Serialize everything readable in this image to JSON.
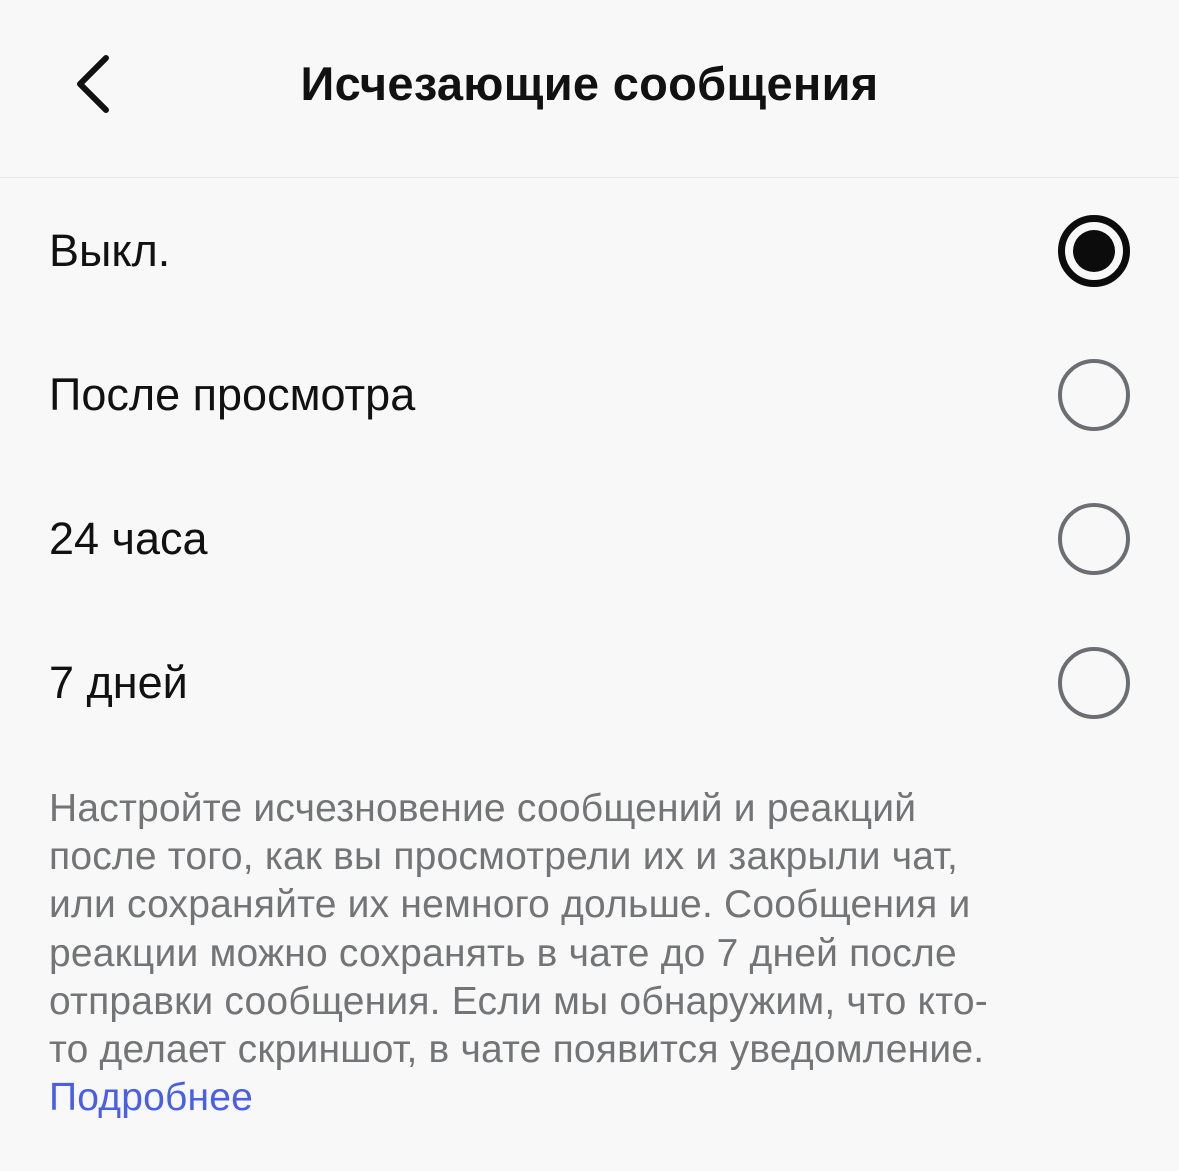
{
  "header": {
    "title": "Исчезающие сообщения",
    "back_icon": "chevron-left-icon"
  },
  "options": [
    {
      "label": "Выкл.",
      "selected": true
    },
    {
      "label": "После просмотра",
      "selected": false
    },
    {
      "label": "24 часа",
      "selected": false
    },
    {
      "label": "7 дней",
      "selected": false
    }
  ],
  "description": {
    "lines": [
      "Настройте исчезновение сообщений и реакций",
      "после того, как вы просмотрели их и закрыли чат,",
      "или сохраняйте их немного дольше. Сообщения и",
      "реакции можно сохранять в чате до 7 дней после",
      "отправки сообщения. Если мы обнаружим, что кто-",
      "то делает скриншот, в чате появится уведомление."
    ],
    "learn_more": "Подробнее"
  },
  "colors": {
    "background": "#f8f8f8",
    "text_primary": "#111111",
    "text_secondary": "#737476",
    "link": "#4a5fe8",
    "radio_unselected": "#6b6e73",
    "radio_selected": "#0c0c0d"
  }
}
